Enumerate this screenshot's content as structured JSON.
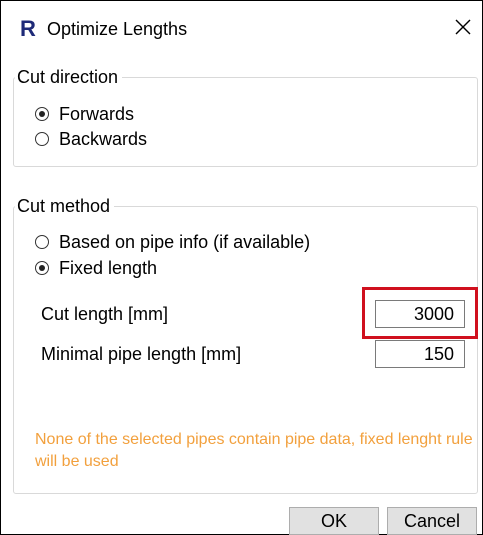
{
  "window": {
    "app_icon_letter": "R",
    "title": "Optimize Lengths",
    "close_glyph": "close-icon"
  },
  "cut_direction": {
    "label": "Cut direction",
    "options": [
      {
        "label": "Forwards",
        "checked": true
      },
      {
        "label": "Backwards",
        "checked": false
      }
    ]
  },
  "cut_method": {
    "label": "Cut method",
    "options": [
      {
        "label": "Based on pipe info (if available)",
        "checked": false
      },
      {
        "label": "Fixed length",
        "checked": true
      }
    ],
    "cut_length": {
      "label": "Cut length [mm]",
      "value": "3000"
    },
    "minimal_pipe_length": {
      "label": "Minimal pipe length [mm]",
      "value": "150"
    },
    "warning": "None of the selected pipes contain pipe data, fixed lenght rule will be used"
  },
  "buttons": {
    "ok": "OK",
    "cancel": "Cancel"
  },
  "colors": {
    "warning_text": "#f2a03d",
    "highlight": "#d0101e",
    "app_icon": "#1e2a78"
  }
}
